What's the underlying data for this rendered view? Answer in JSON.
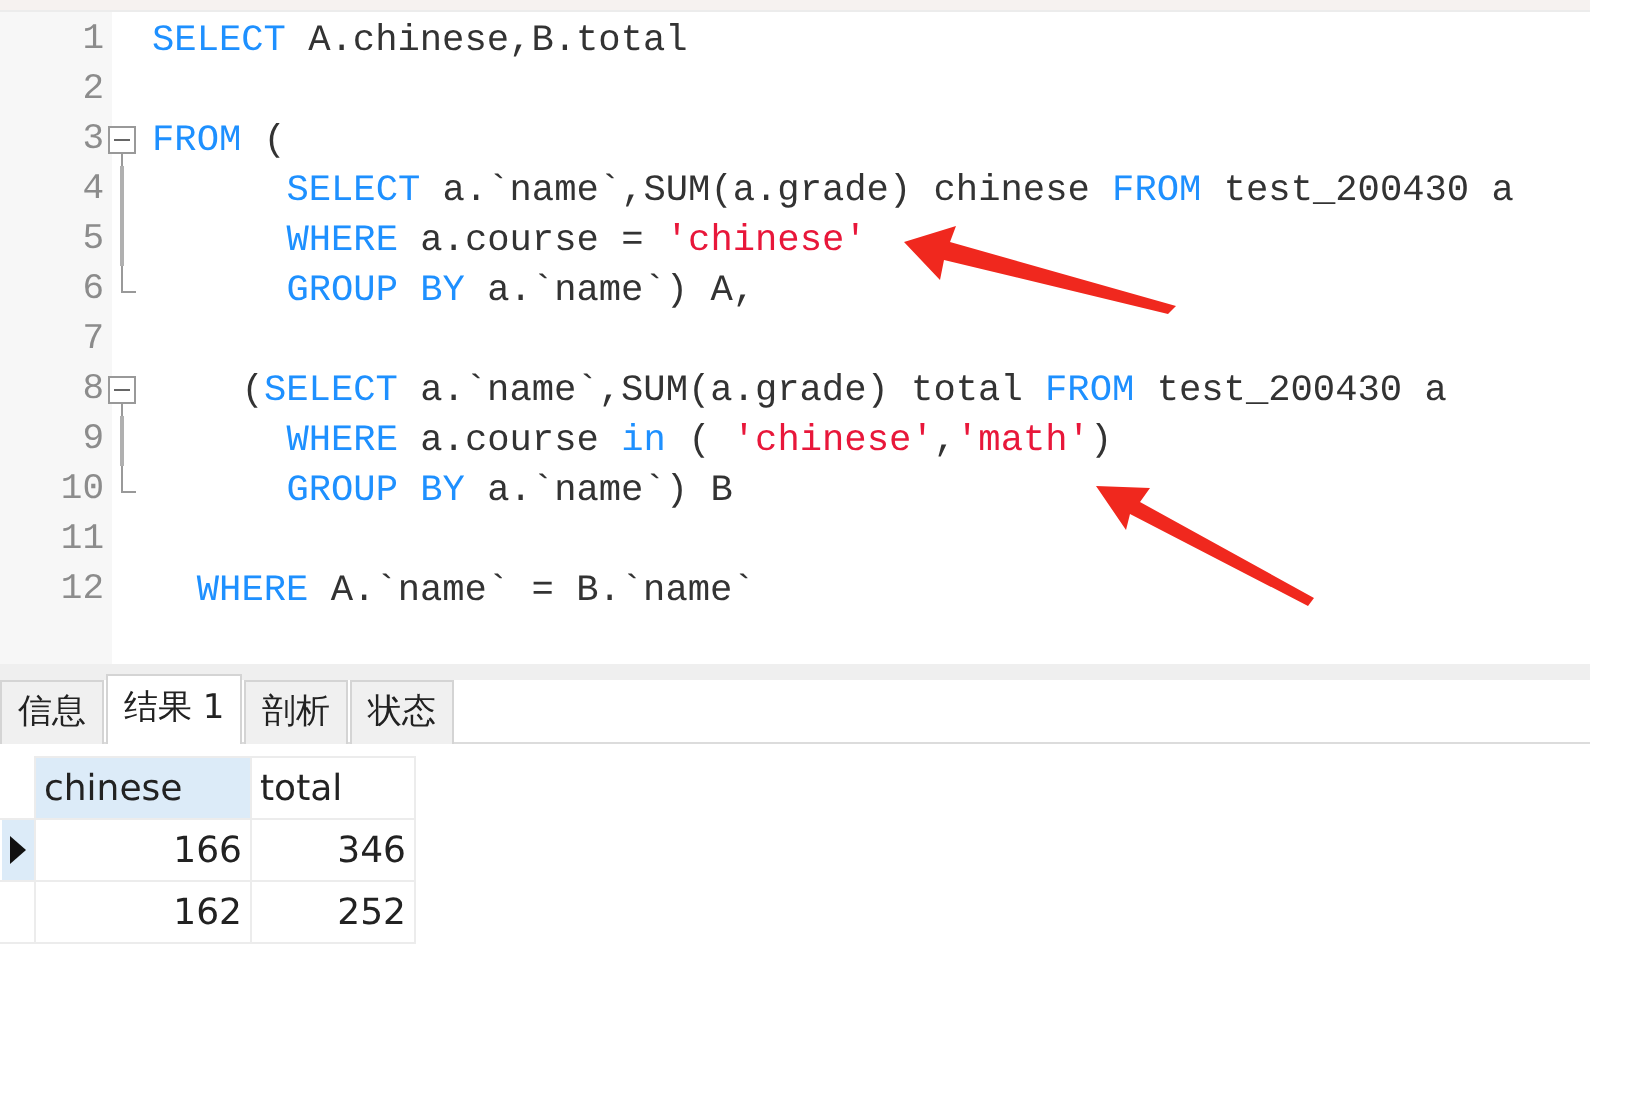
{
  "editor": {
    "lines": [
      {
        "number": "1",
        "kind": "top",
        "fold_start": false,
        "in_fold": false,
        "fold_end": false,
        "tokens": [
          {
            "kind": "keyword",
            "text": "SELECT"
          },
          {
            "kind": "plain",
            "text": " A.chinese,B.total"
          }
        ]
      },
      {
        "number": "2",
        "fold_start": false,
        "in_fold": false,
        "fold_end": false
      },
      {
        "number": "3",
        "kind": "top",
        "fold_start": true,
        "in_fold": false,
        "fold_end": false,
        "tokens": [
          {
            "kind": "keyword",
            "text": "FROM"
          },
          {
            "kind": "plain",
            "text": " ("
          }
        ]
      },
      {
        "number": "4",
        "kind": "inner",
        "fold_start": false,
        "in_fold": true,
        "fold_end": false,
        "tokens": [
          {
            "kind": "keyword",
            "text": "SELECT"
          },
          {
            "kind": "plain",
            "text": " a.`name`,SUM(a.grade) chinese "
          },
          {
            "kind": "keyword",
            "text": "FROM"
          },
          {
            "kind": "plain",
            "text": " test_200430 a"
          }
        ]
      },
      {
        "number": "5",
        "kind": "inner",
        "fold_start": false,
        "in_fold": true,
        "fold_end": false,
        "tokens": [
          {
            "kind": "keyword",
            "text": "WHERE"
          },
          {
            "kind": "plain",
            "text": " a.course = "
          },
          {
            "kind": "string",
            "text": "'chinese'"
          }
        ]
      },
      {
        "number": "6",
        "kind": "inner",
        "fold_start": false,
        "in_fold": false,
        "fold_end": true,
        "tokens": [
          {
            "kind": "keyword",
            "text": "GROUP BY"
          },
          {
            "kind": "plain",
            "text": " a.`name`) A,"
          }
        ]
      },
      {
        "number": "7",
        "fold_start": false,
        "in_fold": false,
        "fold_end": false
      },
      {
        "number": "8",
        "kind": "subquery",
        "fold_start": true,
        "in_fold": false,
        "fold_end": false,
        "tokens": [
          {
            "kind": "plain",
            "text": "("
          },
          {
            "kind": "keyword",
            "text": "SELECT"
          },
          {
            "kind": "plain",
            "text": " a.`name`,SUM(a.grade) total "
          },
          {
            "kind": "keyword",
            "text": "FROM"
          },
          {
            "kind": "plain",
            "text": " test_200430 a"
          }
        ]
      },
      {
        "number": "9",
        "kind": "inner",
        "fold_start": false,
        "in_fold": true,
        "fold_end": false,
        "tokens": [
          {
            "kind": "keyword",
            "text": "WHERE"
          },
          {
            "kind": "plain",
            "text": " a.course "
          },
          {
            "kind": "keyword",
            "text": "in"
          },
          {
            "kind": "plain",
            "text": " ( "
          },
          {
            "kind": "string",
            "text": "'chinese'"
          },
          {
            "kind": "plain",
            "text": ","
          },
          {
            "kind": "string",
            "text": "'math'"
          },
          {
            "kind": "plain",
            "text": ")"
          }
        ]
      },
      {
        "number": "10",
        "kind": "inner",
        "fold_start": false,
        "in_fold": false,
        "fold_end": true,
        "tokens": [
          {
            "kind": "keyword",
            "text": "GROUP BY"
          },
          {
            "kind": "plain",
            "text": " a.`name`) B"
          }
        ]
      },
      {
        "number": "11",
        "fold_start": false,
        "in_fold": false,
        "fold_end": false
      },
      {
        "number": "12",
        "kind": "clause",
        "fold_start": false,
        "in_fold": false,
        "fold_end": false,
        "tokens": [
          {
            "kind": "keyword",
            "text": "WHERE"
          },
          {
            "kind": "plain",
            "text": " A.`name` = B.`name`"
          }
        ]
      }
    ]
  },
  "result_tabs": [
    {
      "label": "信息",
      "selected": false
    },
    {
      "label": "结果 1",
      "selected": true
    },
    {
      "label": "剖析",
      "selected": false
    },
    {
      "label": "状态",
      "selected": false
    }
  ],
  "grid": {
    "columns": [
      {
        "label": "chinese",
        "selected": true
      },
      {
        "label": "total",
        "selected": false
      }
    ],
    "rows": [
      {
        "current": true,
        "cells": [
          "166",
          "346"
        ]
      },
      {
        "current": false,
        "cells": [
          "162",
          "252"
        ]
      }
    ]
  }
}
